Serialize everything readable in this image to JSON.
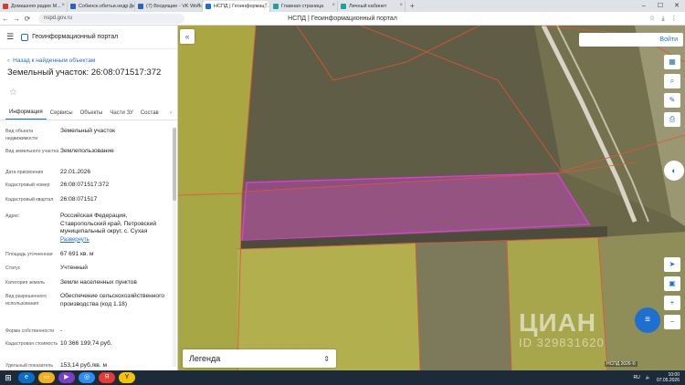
{
  "browser": {
    "tabs": [
      {
        "label": "Домашняя радио М...",
        "color": "#d93c2f",
        "active": false
      },
      {
        "label": "Собинск.обитьи.недр.дея...",
        "color": "#2c62c7",
        "active": false
      },
      {
        "label": "(7) Входящие - VK WorkS...",
        "color": "#2c62c7",
        "active": false
      },
      {
        "label": "НСПД | Геоинформац...",
        "color": "#1f6fd1",
        "active": true
      },
      {
        "label": "Главная страница",
        "color": "#1fa0a0",
        "active": false
      },
      {
        "label": "Личный кабинет",
        "color": "#1fa0a0",
        "active": false
      }
    ],
    "url": "nspd.gov.ru",
    "page_title": "НСПД | Геоинформационный портал"
  },
  "panel": {
    "portal_name": "Геоинформационный портал",
    "back_label": "Назад к найденным объектам",
    "object_title": "Земельный участок: 26:08:071517:372",
    "tabs": [
      "Информация",
      "Сервисы",
      "Объекты",
      "Части ЗУ",
      "Состав"
    ],
    "rows": [
      {
        "label": "Вид объекта недвижимости",
        "value": "Земельный участок"
      },
      {
        "label": "Вид земельного участка",
        "value": "Землепользование"
      },
      {
        "label": "Дата присвоения",
        "value": "22.01.2026"
      },
      {
        "label": "Кадастровый номер",
        "value": "26:08:071517:372"
      },
      {
        "label": "Кадастровый квартал",
        "value": "26:08:071517"
      },
      {
        "label": "Адрес",
        "value": "Российская Федерация, Ставропольский край, Петровский муниципальный округ, с. Сухая",
        "link": "Развернуть"
      },
      {
        "label": "Площадь уточненная",
        "value": "67 691 кв. м"
      },
      {
        "label": "Статус",
        "value": "Учтенный"
      },
      {
        "label": "Категория земель",
        "value": "Земли населенных пунктов"
      },
      {
        "label": "Вид разрешенного использования",
        "value": "Обеспечение сельскохозяйственного производства (код 1.18)"
      },
      {
        "label": "Форма собственности",
        "value": "-"
      },
      {
        "label": "Кадастровая стоимость",
        "value": "10 366 199,74 руб."
      },
      {
        "label": "Удельный показатель",
        "value": "153,14 руб./кв. м"
      }
    ]
  },
  "map": {
    "login_label": "Войти",
    "legend_label": "Легенда",
    "watermark": "ЦИАН",
    "watermark_id": "ID 329831620",
    "scale_label": "НСПД 2026 ©"
  },
  "taskbar": {
    "lang": "RU",
    "time": "10:00",
    "date": "07.05.2026"
  }
}
